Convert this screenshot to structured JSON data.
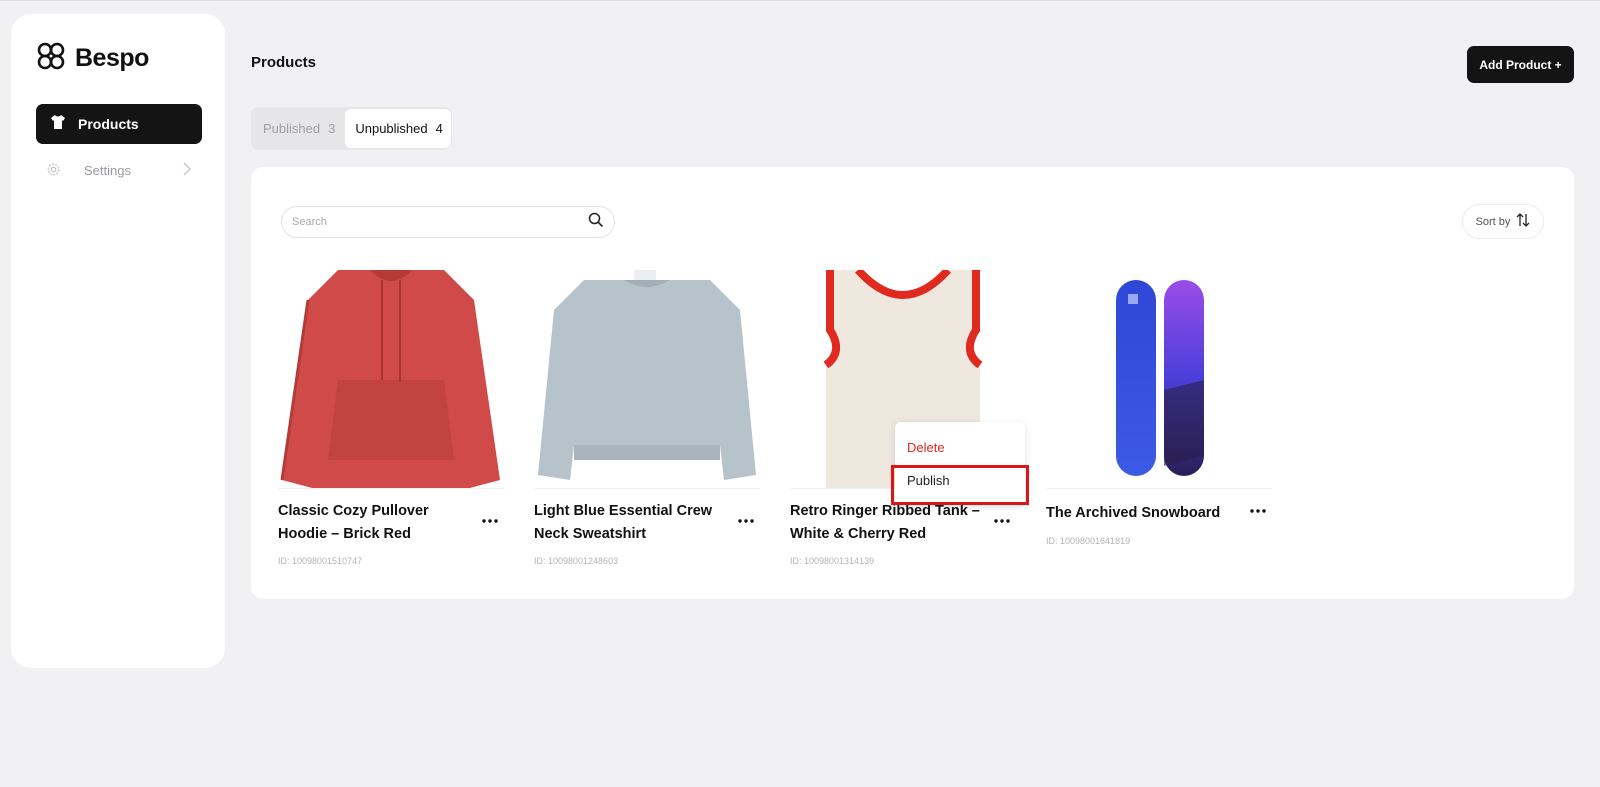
{
  "brand": {
    "name": "Bespo"
  },
  "sidebar": {
    "items": [
      {
        "label": "Products",
        "icon": "tshirt-icon",
        "active": true
      },
      {
        "label": "Settings",
        "icon": "gear-icon",
        "active": false
      }
    ]
  },
  "header": {
    "title": "Products",
    "add_button": "Add Product +"
  },
  "tabs": [
    {
      "label": "Published",
      "count": "3",
      "active": false
    },
    {
      "label": "Unpublished",
      "count": "4",
      "active": true
    }
  ],
  "search": {
    "placeholder": "Search"
  },
  "sort": {
    "label": "Sort by"
  },
  "products": [
    {
      "name": "Classic Cozy Pullover Hoodie – Brick Red",
      "id": "ID: 10098001510747",
      "color": "#cf4a48"
    },
    {
      "name": "Light Blue Essential Crew Neck Sweatshirt",
      "id": "ID: 10098001248603",
      "color": "#b7c3cb"
    },
    {
      "name": "Retro Ringer Ribbed Tank – White & Cherry Red",
      "id": "ID: 10098001314139",
      "color": "#efe8df",
      "trim": "#e02a20"
    },
    {
      "name": "The Archived Snowboard",
      "id": "ID: 10098001641819",
      "color": "#3a4fd8",
      "color2": "#6c3fd8"
    }
  ],
  "menu": {
    "items": [
      "Delete",
      "Publish"
    ]
  }
}
